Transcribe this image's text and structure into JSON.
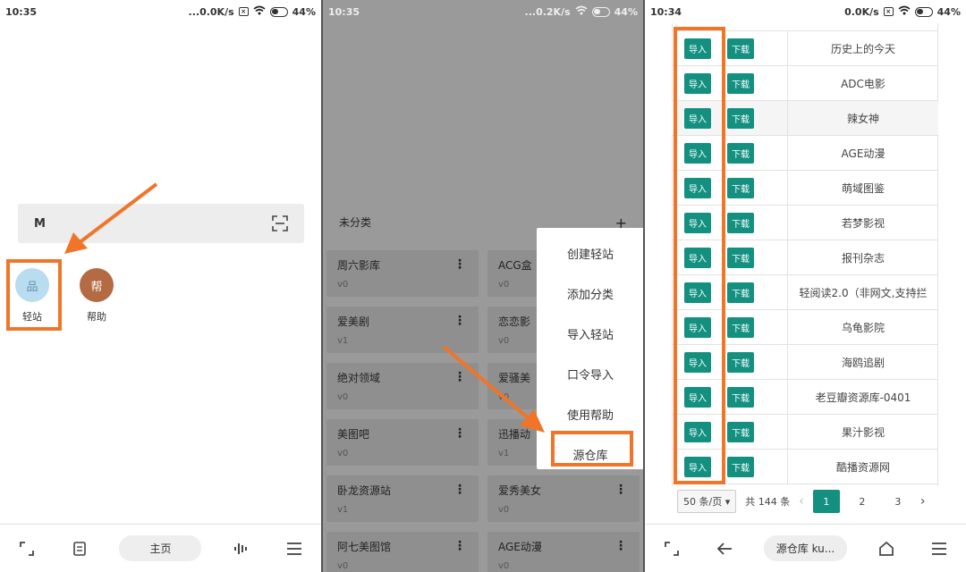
{
  "panel1": {
    "status": {
      "time": "10:35",
      "speed": "...0.0K/s",
      "battery": "44%",
      "x_box": "×"
    },
    "search_m": "M",
    "apps": [
      {
        "label": "轻站",
        "glyph": "品",
        "color": "#b8dcf0"
      },
      {
        "label": "帮助",
        "glyph": "帮",
        "color": "#b46a42"
      }
    ],
    "nav_home": "主页"
  },
  "panel2": {
    "status": {
      "time": "10:35",
      "speed": "...0.2K/s",
      "battery": "44%",
      "x_box": "×"
    },
    "category": "未分类",
    "add": "+",
    "cards": [
      {
        "title": "周六影库",
        "ver": "v0"
      },
      {
        "title": "ACG盒",
        "ver": "v0"
      },
      {
        "title": "爱美剧",
        "ver": "v1"
      },
      {
        "title": "恋恋影",
        "ver": "v0"
      },
      {
        "title": "绝对领域",
        "ver": "v0"
      },
      {
        "title": "爱骚美",
        "ver": "v0"
      },
      {
        "title": "美图吧",
        "ver": "v0"
      },
      {
        "title": "迅播动",
        "ver": "v1"
      },
      {
        "title": "卧龙资源站",
        "ver": "v1"
      },
      {
        "title": "爱秀美女",
        "ver": "v0"
      },
      {
        "title": "阿七美图馆",
        "ver": "v0"
      },
      {
        "title": "AGE动漫",
        "ver": "v0"
      }
    ],
    "menu": [
      "创建轻站",
      "添加分类",
      "导入轻站",
      "口令导入",
      "使用帮助",
      "源仓库"
    ],
    "nav_home": "主页"
  },
  "panel3": {
    "status": {
      "time": "10:34",
      "speed": "0.0K/s",
      "battery": "44%",
      "x_box": "×"
    },
    "import_label": "导入",
    "download_label": "下载",
    "rows": [
      "历史上的今天",
      "ADC电影",
      "辣女神",
      "AGE动漫",
      "萌域图鉴",
      "若梦影视",
      "报刊杂志",
      "轻阅读2.0（非网文,支持拦",
      "乌龟影院",
      "海鸥追剧",
      "老豆瓣资源库-0401",
      "果汁影视",
      "酷播资源网"
    ],
    "pager": {
      "size": "50 条/页 ▾",
      "total": "共 144 条",
      "prev": "‹",
      "pages": [
        "1",
        "2",
        "3"
      ],
      "next": "›"
    },
    "nav_title": "源仓库 ku..."
  },
  "colors": {
    "accent": "#f07528",
    "teal": "#149081"
  }
}
